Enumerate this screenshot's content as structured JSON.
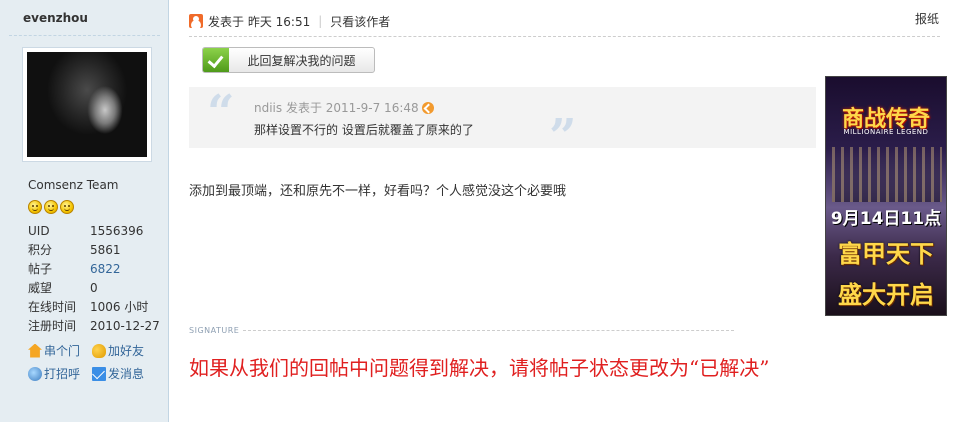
{
  "sidebar": {
    "username": "evenzhou",
    "group": "Comsenz Team",
    "stats": [
      {
        "key": "UID",
        "value": "1556396"
      },
      {
        "key": "积分",
        "value": "5861"
      },
      {
        "key": "帖子",
        "value": "6822"
      },
      {
        "key": "威望",
        "value": "0"
      },
      {
        "key": "在线时间",
        "value": "1006 小时"
      },
      {
        "key": "注册时间",
        "value": "2010-12-27"
      }
    ],
    "actions": {
      "visit": "串个门",
      "add_friend": "加好友",
      "poke": "打招呼",
      "message": "发消息"
    }
  },
  "post": {
    "posted_at": "发表于 昨天 16:51",
    "only_author": "只看该作者",
    "report": "报纸",
    "solved_button": "此回复解决我的问题",
    "quote": {
      "meta": "ndiis 发表于 2011-9-7 16:48",
      "text": "那样设置不行的  设置后就覆盖了原来的了"
    },
    "message": "添加到最顶端，还和原先不一样，好看吗？个人感觉没这个必要哦",
    "signature_label": "SIGNATURE",
    "signature_text": "如果从我们的回帖中问题得到解决，请将帖子状态更改为“已解决”"
  },
  "ad": {
    "title": "商战传奇",
    "subtitle": "MILLIONAIRE LEGEND",
    "date": "9月14日11点",
    "line1": "富甲天下",
    "line2": "盛大开启"
  },
  "colors": {
    "sidebar_bg": "#e5edf2",
    "link": "#336699",
    "signature": "#e02020"
  },
  "icons": [
    "online-status-icon",
    "check-icon",
    "quote-open-icon",
    "quote-close-icon",
    "jump-to-post-icon",
    "smiley-icon",
    "home-icon",
    "friend-icon",
    "poke-icon",
    "mail-icon"
  ]
}
